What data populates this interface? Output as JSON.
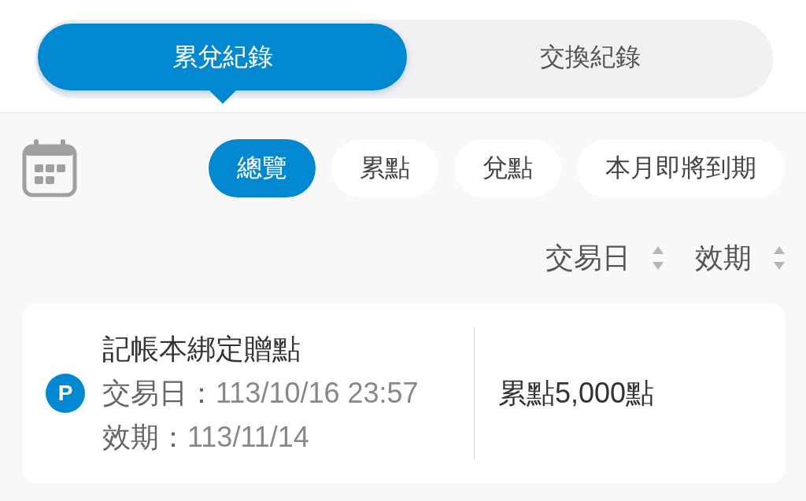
{
  "tabs": [
    {
      "label": "累兌紀錄",
      "selected": true
    },
    {
      "label": "交換紀錄",
      "selected": false
    }
  ],
  "filters": [
    {
      "label": "總覽",
      "selected": true
    },
    {
      "label": "累點",
      "selected": false
    },
    {
      "label": "兌點",
      "selected": false
    },
    {
      "label": "本月即將到期",
      "selected": false
    }
  ],
  "sort": [
    {
      "label": "交易日"
    },
    {
      "label": "效期"
    }
  ],
  "records": [
    {
      "badge": "P",
      "title": "記帳本綁定贈點",
      "fields": [
        {
          "label": "交易日：",
          "value": "113/10/16 23:57"
        },
        {
          "label": "效期：",
          "value": "113/11/14"
        }
      ],
      "amount": "累點5,000點"
    }
  ]
}
